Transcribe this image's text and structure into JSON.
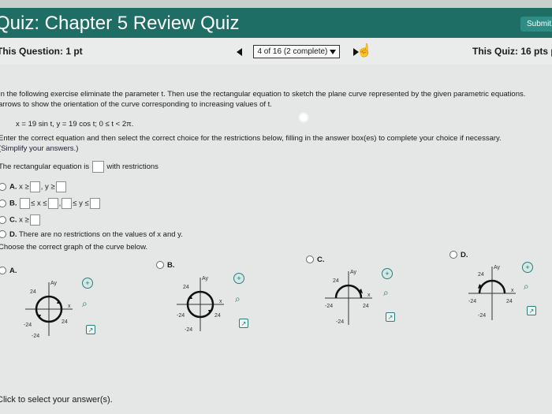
{
  "header": {
    "title": "Quiz: Chapter 5 Review Quiz",
    "submit_label": "Submit"
  },
  "infobar": {
    "this_question": "This Question: 1 pt",
    "progress": "4 of 16 (2 complete)",
    "this_quiz": "This Quiz: 16 pts po"
  },
  "question": {
    "instruction_line1": "In the following exercise eliminate the parameter t. Then use the rectangular equation to sketch the plane curve represented by the given parametric equations.",
    "instruction_line2": "arrows to show the orientation of the curve corresponding to increasing values of t.",
    "equations": "x = 19 sin t, y = 19 cos t; 0 ≤ t < 2π.",
    "enter_line": "Enter the correct equation and then select the correct choice for the restrictions below, filling in the answer box(es) to complete your choice if necessary.",
    "simplify": "(Simplify your answers.)",
    "rect_eq_prefix": "The rectangular equation is",
    "rect_eq_suffix": "with restrictions"
  },
  "choices": {
    "a_label": "A.",
    "a_x": "x ≥",
    "a_y": ", y ≥",
    "b_label": "B.",
    "b_le_x_le": "≤ x ≤",
    "b_le_y_le": "≤ y ≤",
    "c_label": "C.",
    "c_x": "x ≥",
    "d_label": "D.",
    "d_text": "There are no restrictions on the values of x and y."
  },
  "graph_prompt": "Choose the correct graph of the curve below.",
  "graphs": {
    "a": {
      "label": "A.",
      "tick": "24",
      "neg_tick": "-24",
      "x_axis": "x",
      "y_axis": "Ay"
    },
    "b": {
      "label": "B.",
      "tick": "24",
      "neg_tick": "-24",
      "x_axis": "x",
      "y_axis": "Ay"
    },
    "c": {
      "label": "C.",
      "tick": "24",
      "neg_tick": "-24",
      "x_axis": "x",
      "y_axis": "Ay"
    },
    "d": {
      "label": "D.",
      "tick": "24",
      "neg_tick": "-24",
      "x_axis": "x",
      "y_axis": "Ay"
    }
  },
  "footer": "Click to select your answer(s).",
  "colors": {
    "header": "#1f6e66",
    "accent": "#2d7e78"
  }
}
